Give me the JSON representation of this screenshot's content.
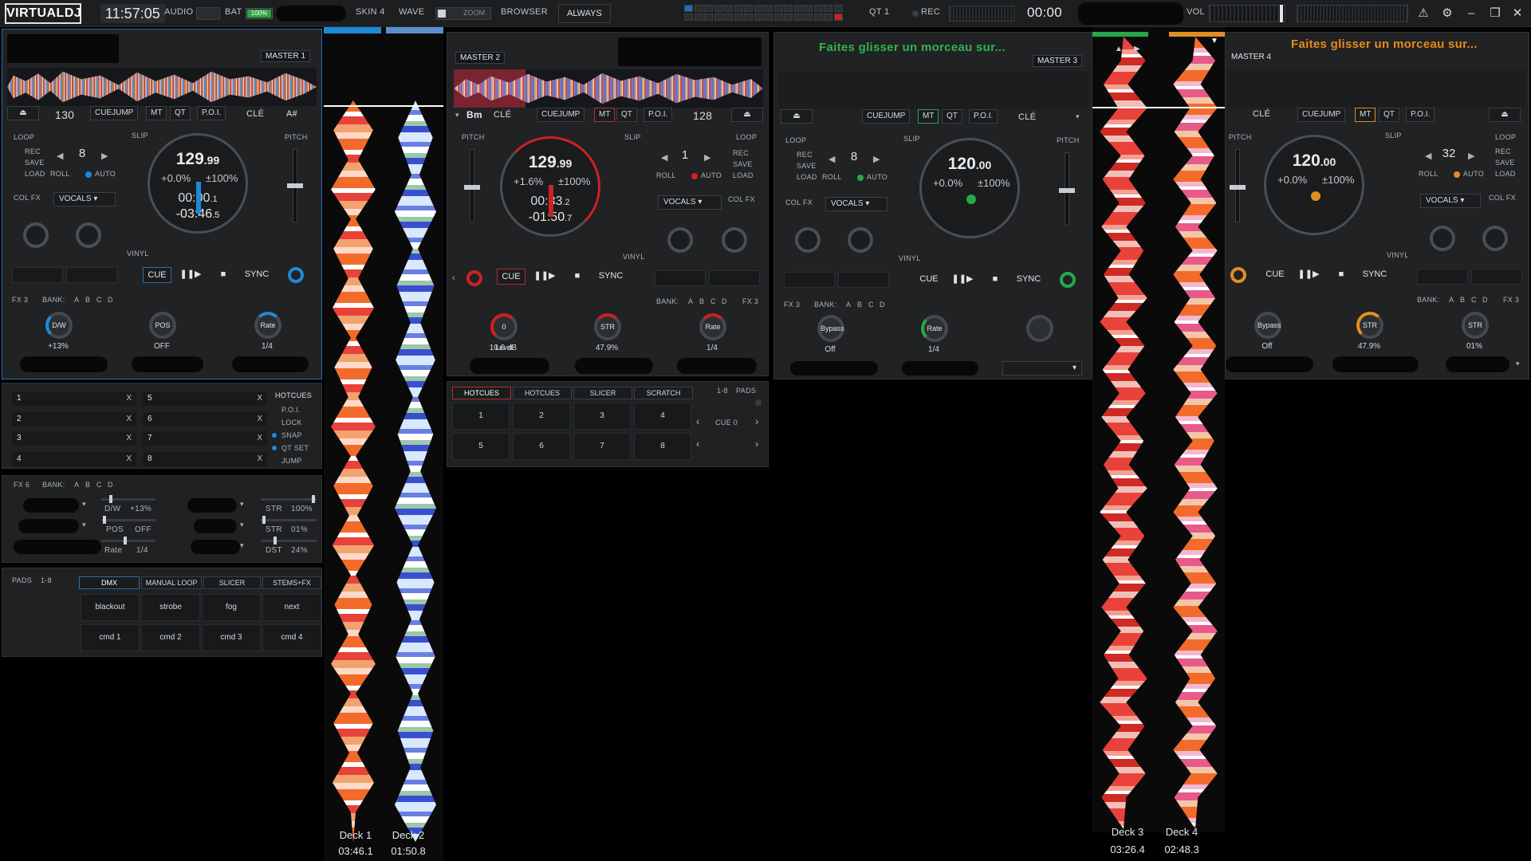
{
  "topbar": {
    "logo": "VIRTUALDJ",
    "clock": "11:57:05",
    "audio_label": "AUDIO",
    "bat_label": "BAT",
    "battery_text": "100%",
    "battery_level": 1.0,
    "skin": "SKIN 4",
    "wave": "WAVE",
    "zoom": "ZOOM",
    "browser": "BROWSER",
    "always": "ALWAYS",
    "qt": "QT 1",
    "rec": "REC",
    "rec_time": "00:00",
    "vol": "VOL"
  },
  "decks": {
    "d1": {
      "master": "MASTER 1",
      "bpm_small": "130",
      "cuejump": "CUEJUMP",
      "mt": "MT",
      "qt": "QT",
      "poi": "P.O.I.",
      "cle": "CLÉ",
      "key": "A#",
      "slip": "SLIP",
      "pitch": "PITCH",
      "loop": "LOOP",
      "rec": "REC",
      "save": "SAVE",
      "load": "LOAD",
      "roll": "ROLL",
      "auto": "AUTO",
      "loop_value": "8",
      "colfx": "COL FX",
      "vocals": "VOCALS",
      "vinyl": "VINYL",
      "bpm_int": "129",
      "bpm_dec": ".99",
      "pitch_pct": "+0.0%",
      "pitch_range": "±100%",
      "elapsed": "00:00",
      "elapsed_dec": ".1",
      "remain": "-03:46",
      "remain_dec": ".5",
      "cue": "CUE",
      "play": "❚❚▶",
      "stop": "■",
      "sync": "SYNC",
      "fx": "FX 3",
      "bank": "BANK:",
      "bank_letters": [
        "A",
        "B",
        "C",
        "D"
      ],
      "fx_knobs": [
        {
          "label": "D/W",
          "value": "+13%"
        },
        {
          "label": "POS",
          "value": "OFF"
        },
        {
          "label": "Rate",
          "value": "1/4"
        }
      ]
    },
    "d2": {
      "master": "MASTER 2",
      "key": "Bm",
      "cle": "CLÉ",
      "cuejump": "CUEJUMP",
      "mt": "MT",
      "qt": "QT",
      "poi": "P.O.I.",
      "bpm_small": "128",
      "pitch": "PITCH",
      "slip": "SLIP",
      "loop": "LOOP",
      "loop_value": "1",
      "rec": "REC",
      "save": "SAVE",
      "load": "LOAD",
      "roll": "ROLL",
      "auto": "AUTO",
      "vocals": "VOCALS",
      "colfx": "COL FX",
      "vinyl": "VINYL",
      "bpm_int": "129",
      "bpm_dec": ".99",
      "pitch_pct": "+1.6%",
      "pitch_range": "±100%",
      "elapsed": "00:33",
      "elapsed_dec": ".2",
      "remain": "-01:50",
      "remain_dec": ".7",
      "cue": "CUE",
      "play": "❚❚▶",
      "stop": "■",
      "sync": "SYNC",
      "bank": "BANK:",
      "bank_letters": [
        "A",
        "B",
        "C",
        "D"
      ],
      "fx": "FX 3",
      "fx_knobs": [
        {
          "label": "0 Level",
          "value": "10.0 dB"
        },
        {
          "label": "STR",
          "value": "47.9%"
        },
        {
          "label": "Rate",
          "value": "1/4"
        }
      ]
    },
    "d3": {
      "drop_text": "Faites glisser un morceau sur...",
      "master": "MASTER 3",
      "cuejump": "CUEJUMP",
      "mt": "MT",
      "qt": "QT",
      "poi": "P.O.I.",
      "cle": "CLÉ",
      "loop": "LOOP",
      "slip": "SLIP",
      "pitch": "PITCH",
      "rec": "REC",
      "save": "SAVE",
      "load": "LOAD",
      "roll": "ROLL",
      "auto": "AUTO",
      "loop_value": "8",
      "colfx": "COL FX",
      "vocals": "VOCALS",
      "vinyl": "VINYL",
      "bpm_int": "120",
      "bpm_dec": ".00",
      "pitch_pct": "+0.0%",
      "pitch_range": "±100%",
      "cue": "CUE",
      "play": "❚❚▶",
      "stop": "■",
      "sync": "SYNC",
      "fx": "FX 3",
      "bank": "BANK:",
      "bank_letters": [
        "A",
        "B",
        "C",
        "D"
      ],
      "fx_knobs": [
        {
          "label": "Bypass",
          "value": "Off"
        },
        {
          "label": "Rate",
          "value": "1/4"
        },
        {
          "label": "",
          "value": ""
        }
      ]
    },
    "d4": {
      "drop_text": "Faites glisser un morceau sur...",
      "master": "MASTER 4",
      "cle": "CLÉ",
      "cuejump": "CUEJUMP",
      "mt": "MT",
      "qt": "QT",
      "poi": "P.O.I.",
      "pitch": "PITCH",
      "slip": "SLIP",
      "loop": "LOOP",
      "loop_value": "32",
      "rec": "REC",
      "save": "SAVE",
      "load": "LOAD",
      "roll": "ROLL",
      "auto": "AUTO",
      "vocals": "VOCALS",
      "colfx": "COL FX",
      "vinyl": "VINYL",
      "bpm_int": "120",
      "bpm_dec": ".00",
      "pitch_pct": "+0.0%",
      "pitch_range": "±100%",
      "cue": "CUE",
      "play": "❚❚▶",
      "stop": "■",
      "sync": "SYNC",
      "bank": "BANK:",
      "bank_letters": [
        "A",
        "B",
        "C",
        "D"
      ],
      "fx": "FX 3",
      "fx_knobs": [
        {
          "label": "Bypass",
          "value": "Off"
        },
        {
          "label": "STR",
          "value": "47.9%"
        },
        {
          "label": "STR",
          "value": "01%"
        }
      ]
    }
  },
  "hotcues_panel": {
    "rows": [
      {
        "n": "1",
        "x": "X"
      },
      {
        "n": "2",
        "x": "X"
      },
      {
        "n": "3",
        "x": "X"
      },
      {
        "n": "4",
        "x": "X"
      },
      {
        "n": "5",
        "x": "X"
      },
      {
        "n": "6",
        "x": "X"
      },
      {
        "n": "7",
        "x": "X"
      },
      {
        "n": "8",
        "x": "X"
      }
    ],
    "side": [
      "HOTCUES",
      "P.O.I.",
      "LOCK",
      "SNAP",
      "QT SET",
      "JUMP"
    ]
  },
  "fx6_panel": {
    "fx": "FX 6",
    "bank": "BANK:",
    "bank_letters": [
      "A",
      "B",
      "C",
      "D"
    ],
    "params": [
      {
        "label": "D/W",
        "value": "+13%"
      },
      {
        "label": "STR",
        "value": "100%"
      },
      {
        "label": "POS",
        "value": "OFF"
      },
      {
        "label": "STR",
        "value": "01%"
      },
      {
        "label": "Rate",
        "value": "1/4"
      },
      {
        "label": "DST",
        "value": "24%"
      }
    ]
  },
  "pads_panel": {
    "title": "PADS",
    "range": "1-8",
    "tabs": [
      "DMX",
      "MANUAL LOOP",
      "SLICER",
      "STEMS+FX"
    ],
    "pads": [
      "blackout",
      "strobe",
      "fog",
      "next",
      "cmd 1",
      "cmd 2",
      "cmd 3",
      "cmd 4"
    ]
  },
  "pads2_panel": {
    "tabs": [
      "HOTCUES",
      "HOTCUES",
      "SLICER",
      "SCRATCH"
    ],
    "range": "1-8",
    "title": "PADS",
    "pads": [
      "1",
      "2",
      "3",
      "4",
      "5",
      "6",
      "7",
      "8"
    ],
    "cue": "CUE 0"
  },
  "vertical_waves": {
    "left": {
      "deck1": "Deck 1",
      "deck2": "Deck 2",
      "time1": "03:46.1",
      "time2": "01:50.8"
    },
    "right": {
      "deck3": "Deck 3",
      "deck4": "Deck 4",
      "time3": "03:26.4",
      "time4": "02:48.3"
    }
  },
  "colors": {
    "accent_blue": "#1e8ad6",
    "accent_red": "#c22",
    "accent_green": "#26a84a",
    "accent_orange": "#e08e23",
    "drop_green": "#2fb350",
    "drop_orange": "#e88a1a"
  }
}
